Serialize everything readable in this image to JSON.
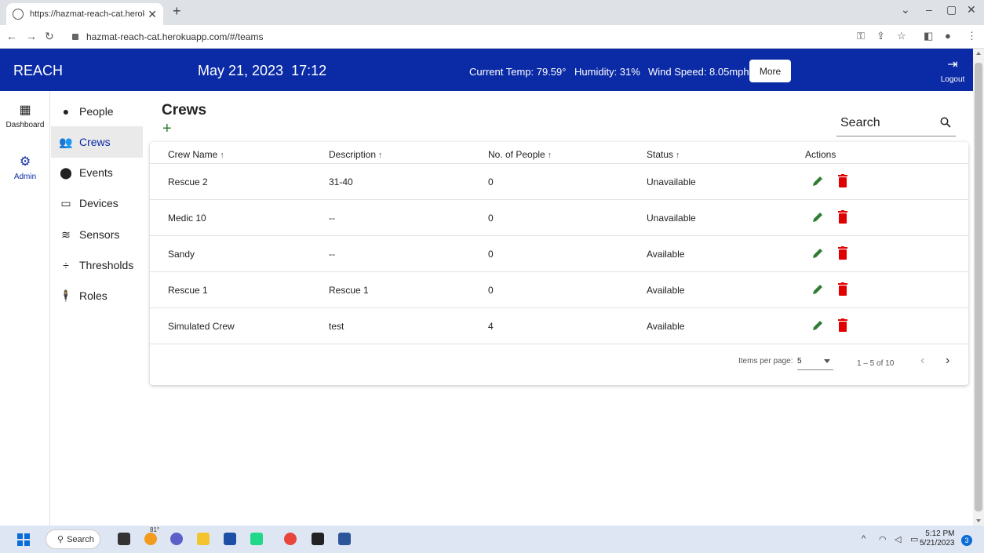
{
  "browser": {
    "tab_title": "https://hazmat-reach-cat.heroku",
    "url": "hazmat-reach-cat.herokuapp.com/#/teams"
  },
  "header": {
    "brand": "REACH",
    "date": "May 21, 2023",
    "time": "17:12",
    "temp": "Current Temp: 79.59°",
    "humidity": "Humidity: 31%",
    "wind": "Wind Speed: 8.05mph",
    "more_label": "More",
    "logout_label": "Logout"
  },
  "rail": {
    "dashboard_label": "Dashboard",
    "admin_label": "Admin"
  },
  "sidebar": {
    "items": [
      {
        "label": "People"
      },
      {
        "label": "Crews"
      },
      {
        "label": "Events"
      },
      {
        "label": "Devices"
      },
      {
        "label": "Sensors"
      },
      {
        "label": "Thresholds"
      },
      {
        "label": "Roles"
      }
    ]
  },
  "page": {
    "title": "Crews",
    "add_label": "+",
    "search_label": "Search"
  },
  "table": {
    "columns": [
      "Crew Name",
      "Description",
      "No. of People",
      "Status",
      "Actions"
    ],
    "rows": [
      {
        "name": "Rescue 2",
        "description": "31-40",
        "people": "0",
        "status": "Unavailable"
      },
      {
        "name": "Medic 10",
        "description": "--",
        "people": "0",
        "status": "Unavailable"
      },
      {
        "name": "Sandy",
        "description": "--",
        "people": "0",
        "status": "Available"
      },
      {
        "name": "Rescue 1",
        "description": "Rescue 1",
        "people": "0",
        "status": "Available"
      },
      {
        "name": "Simulated Crew",
        "description": "test",
        "people": "4",
        "status": "Available"
      }
    ],
    "pager": {
      "items_per_page_label": "Items per page:",
      "items_per_page": "5",
      "range": "1 – 5 of 10"
    }
  },
  "taskbar": {
    "search_label": "Search",
    "weather": "81°",
    "time": "5:12 PM",
    "date": "5/21/2023",
    "notifications": "3"
  },
  "colors": {
    "header_bg": "#0b2ba6",
    "edit": "#2e7d32",
    "delete": "#e00000"
  }
}
